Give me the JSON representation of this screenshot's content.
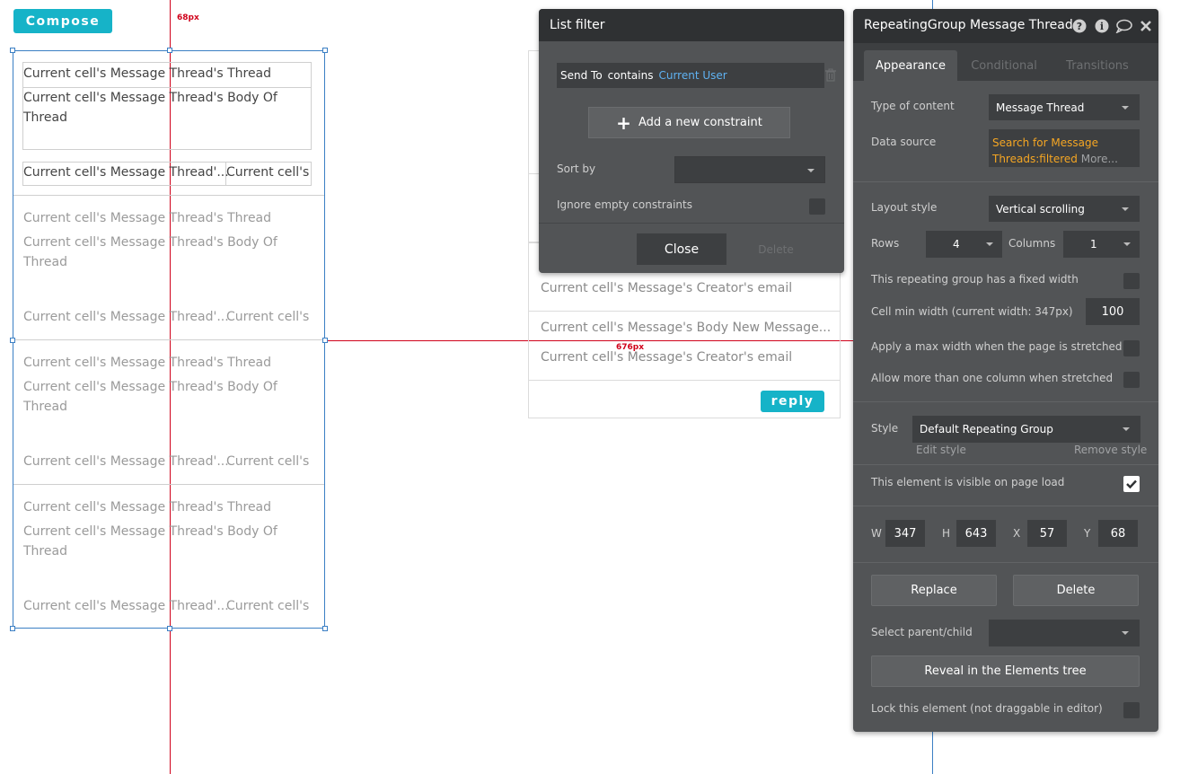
{
  "canvas": {
    "compose_label": "Compose",
    "top_measure": "68px",
    "horizontal_measure": "676px",
    "cell_title": "Current cell's Message Thread's Thread",
    "cell_body_line1": "Current cell's Message Thread's Body Of",
    "cell_body_line2": "Thread",
    "cell_footer_left": "Current cell's Message Thread'...",
    "cell_footer_right": "Current cell's",
    "middle": {
      "creator_email": "Current cell's Message's Creator's email",
      "body_new_message": "Current cell's Message's Body New Message...",
      "creator_email_2": "Current cell's Message's Creator's email",
      "reply_label": "reply"
    }
  },
  "list_filter": {
    "title": "List filter",
    "constraint_field": "Send To",
    "constraint_op": "contains",
    "constraint_value": "Current User",
    "add_constraint_label": "Add a new constraint",
    "sort_by_label": "Sort by",
    "sort_by_value": "",
    "ignore_empty_label": "Ignore empty constraints",
    "close_label": "Close",
    "delete_label": "Delete"
  },
  "property_panel": {
    "title": "RepeatingGroup Message Thread",
    "tabs": [
      "Appearance",
      "Conditional",
      "Transitions"
    ],
    "type_of_content_label": "Type of content",
    "type_of_content_value": "Message Thread",
    "data_source_label": "Data source",
    "data_source_line1": "Search for Message",
    "data_source_line2": "Threads:filtered",
    "data_source_more": "More...",
    "layout_style_label": "Layout style",
    "layout_style_value": "Vertical scrolling",
    "rows_label": "Rows",
    "rows_value": "4",
    "columns_label": "Columns",
    "columns_value": "1",
    "fixed_width_label": "This repeating group has a fixed width",
    "cell_min_width_label": "Cell min width (current width: 347px)",
    "cell_min_width_value": "100",
    "max_width_label": "Apply a max width when the page is stretched",
    "multi_column_label": "Allow more than one column when stretched",
    "style_label": "Style",
    "style_value": "Default Repeating Group",
    "edit_style": "Edit style",
    "remove_style": "Remove style",
    "visible_label": "This element is visible on page load",
    "visible_checked": true,
    "w_label": "W",
    "w_value": "347",
    "h_label": "H",
    "h_value": "643",
    "x_label": "X",
    "x_value": "57",
    "y_label": "Y",
    "y_value": "68",
    "replace_label": "Replace",
    "delete_label": "Delete",
    "parent_child_label": "Select parent/child",
    "reveal_label": "Reveal in the Elements tree",
    "lock_label": "Lock this element (not draggable in editor)",
    "accent_orange": "#f5a623",
    "accent_blue": "#5fb2f2"
  }
}
